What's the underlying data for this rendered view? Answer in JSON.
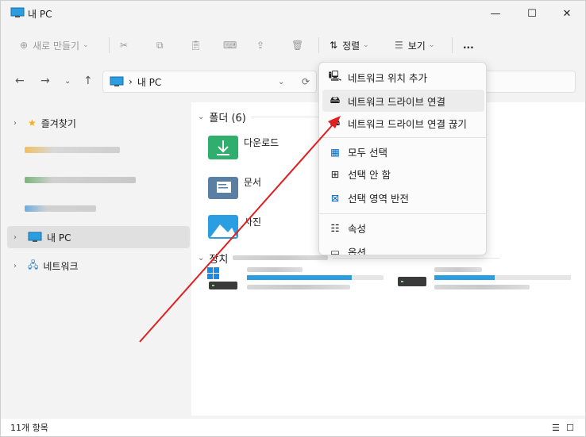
{
  "window": {
    "title": "내 PC"
  },
  "toolbar": {
    "new_label": "새로 만들기",
    "sort_label": "정렬",
    "view_label": "보기",
    "more_label": "..."
  },
  "address": {
    "location": "내 PC"
  },
  "sidebar": {
    "favorites": "즐겨찾기",
    "this_pc": "내 PC",
    "network": "네트워크"
  },
  "content": {
    "folders_header": "폴더 (6)",
    "folders": [
      "다운로드",
      "문서",
      "사진"
    ],
    "devices_header": "장치"
  },
  "status": {
    "item_count": "11개 항목"
  },
  "context_menu": {
    "items": [
      "네트워크 위치 추가",
      "네트워크 드라이브 연결",
      "네트워크 드라이브 연결 끊기",
      "모두 선택",
      "선택 안 함",
      "선택 영역 반전",
      "속성",
      "옵션"
    ]
  },
  "colors": {
    "accent": "#0067c0",
    "arrow": "#e02020",
    "drive_bar": "#2a9ee0"
  }
}
